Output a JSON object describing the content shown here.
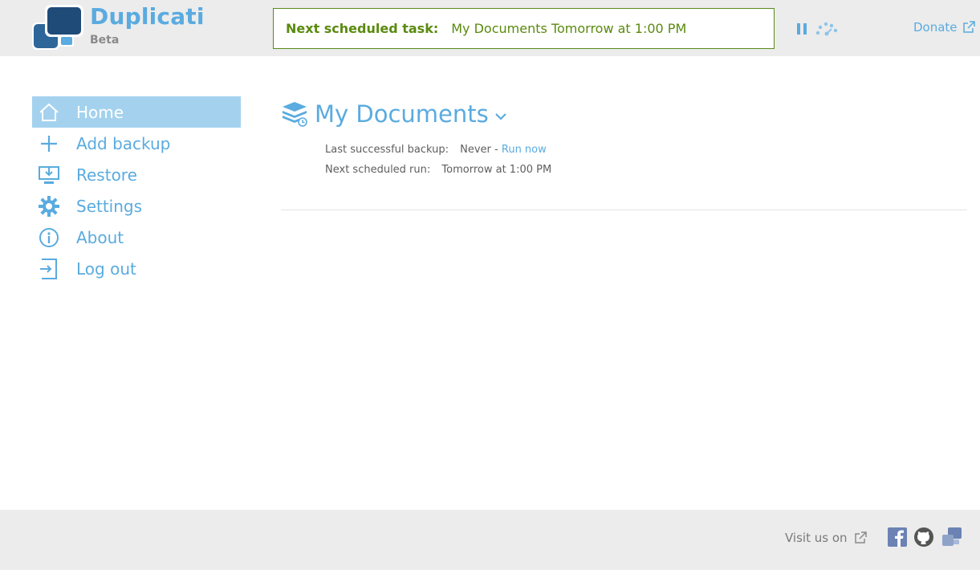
{
  "brand": {
    "name": "Duplicati",
    "subtitle": "Beta"
  },
  "header": {
    "task_label": "Next scheduled task:",
    "task_value": "My Documents Tomorrow at 1:00 PM",
    "donate": "Donate"
  },
  "sidebar": {
    "items": [
      {
        "label": "Home",
        "icon": "home-icon",
        "active": true
      },
      {
        "label": "Add backup",
        "icon": "plus-icon"
      },
      {
        "label": "Restore",
        "icon": "restore-icon"
      },
      {
        "label": "Settings",
        "icon": "gear-icon"
      },
      {
        "label": "About",
        "icon": "info-icon"
      },
      {
        "label": "Log out",
        "icon": "logout-icon"
      }
    ]
  },
  "main": {
    "backup": {
      "title": "My Documents",
      "last_backup_label": "Last successful backup:",
      "last_backup_value": "Never -",
      "run_now": "Run now",
      "next_run_label": "Next scheduled run:",
      "next_run_value": "Tomorrow at 1:00 PM"
    }
  },
  "footer": {
    "visit": "Visit us on"
  },
  "colors": {
    "accent": "#5aabdf",
    "active_bg": "#a4d2ee",
    "task_green": "#5a8a0f",
    "header_bg": "#ececec"
  }
}
